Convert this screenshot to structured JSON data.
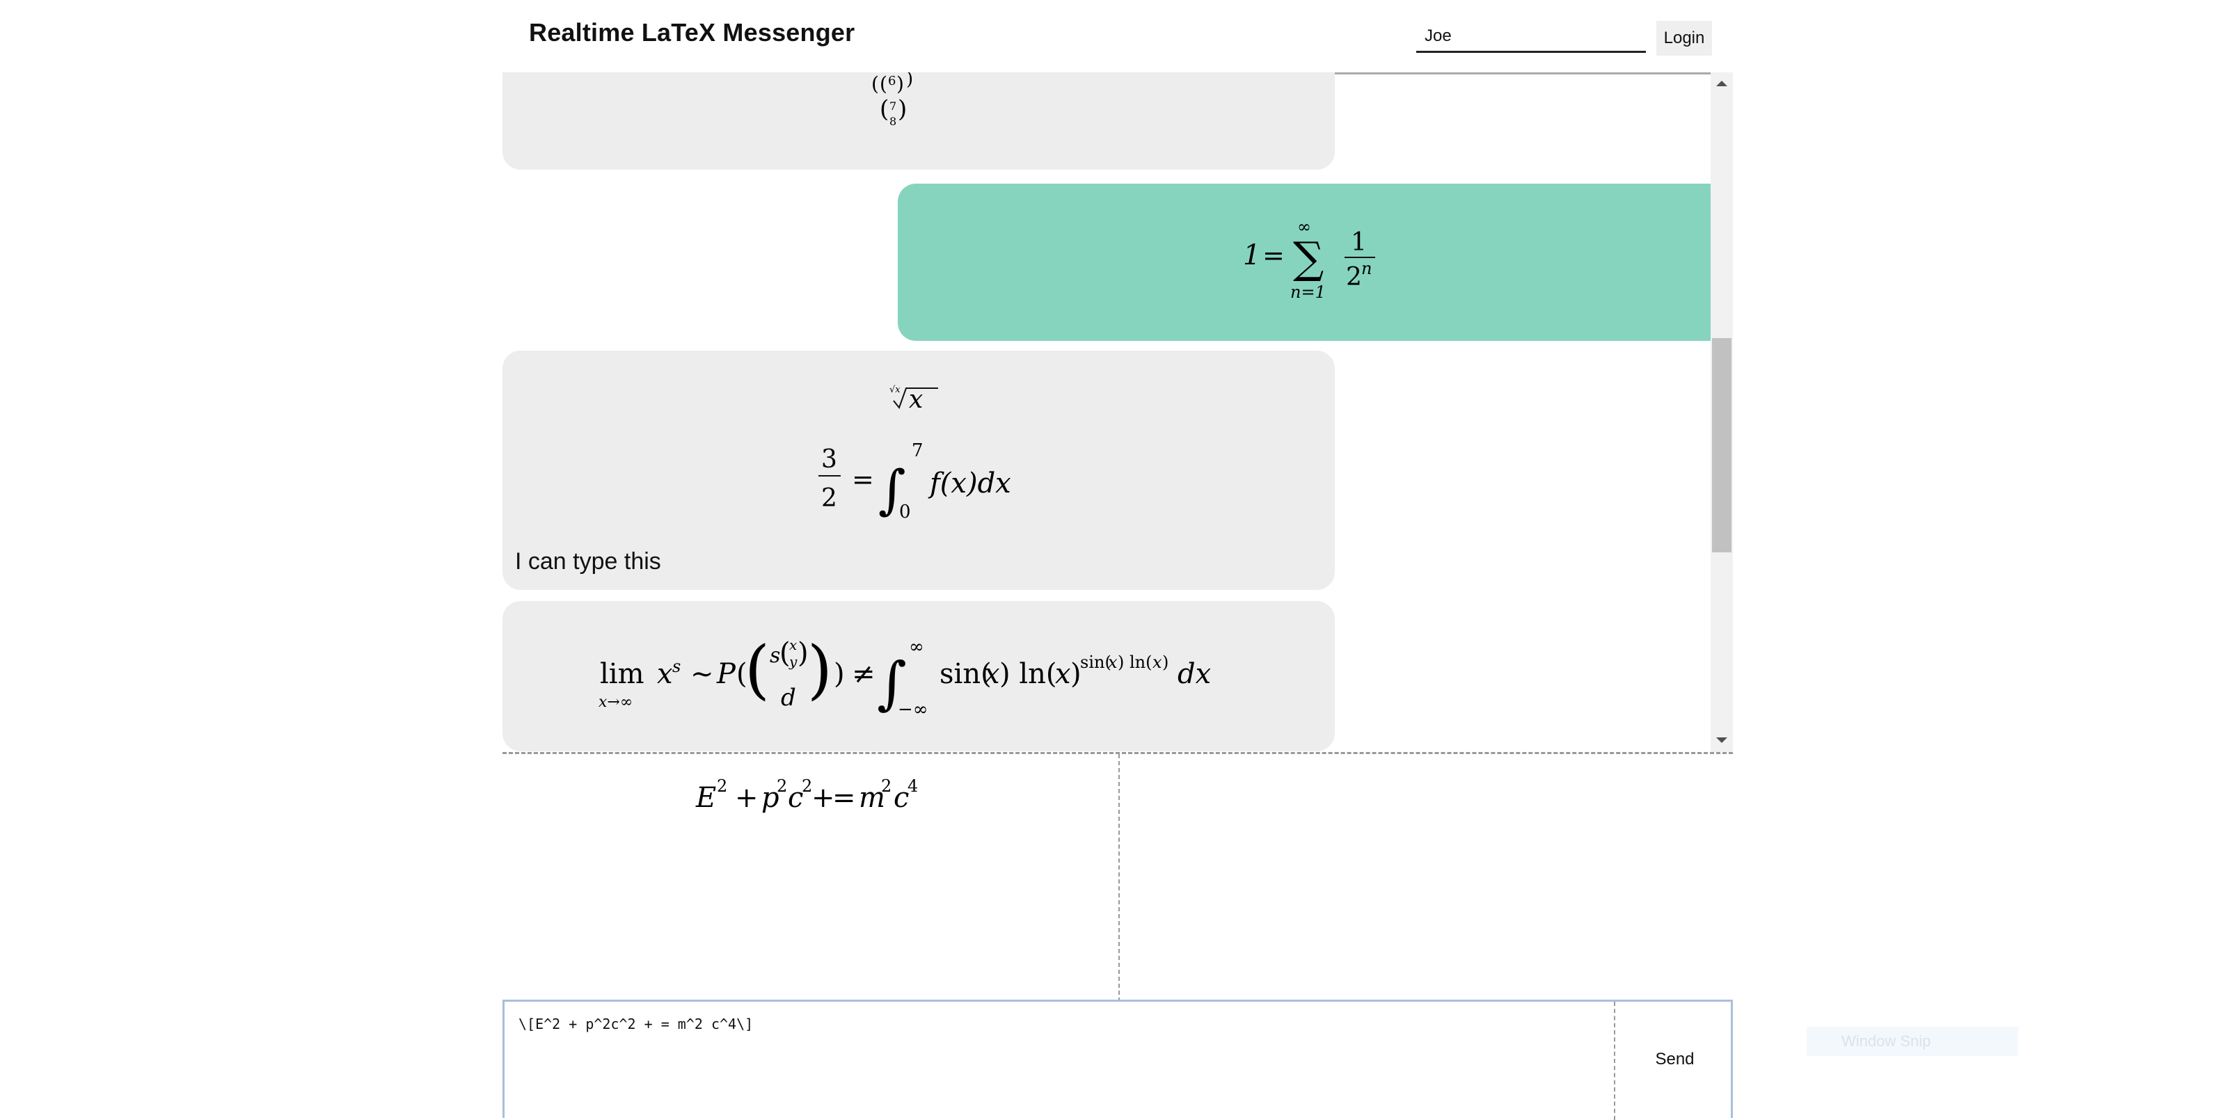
{
  "header": {
    "title": "Realtime LaTeX Messenger",
    "username": "Joe",
    "login_label": "Login"
  },
  "messages": [
    {
      "sender": "other",
      "source": "\\binom{6}{\\binom{7}{8}}"
    },
    {
      "sender": "self",
      "source": "1 = \\sum_{n=1}^{\\infty} \\frac{1}{2^n}"
    },
    {
      "sender": "other",
      "source": "\\sqrt[\\sqrt{x}]{x} \\quad \\frac{3}{2} = \\int_0^7 f(x)dx",
      "text": "I can type this"
    },
    {
      "sender": "other",
      "source": "\\lim_{x\\to\\infty} x^s \\sim P(\\binom{s\\binom{x}{y}}{d}) \\neq \\int_{-\\infty}^{\\infty} \\sin(x)\\ln(x)^{\\sin(x)\\ln(x)} dx"
    }
  ],
  "preview": {
    "source": "E^2 + p^2 c^2 + = m^2 c^4"
  },
  "composer": {
    "value": "\\[E^2 + p^2c^2 + = m^2 c^4\\]",
    "send_label": "Send"
  },
  "overlay": {
    "label": "Window Snip"
  },
  "colors": {
    "own_bubble": "#86d4bd",
    "other_bubble": "#ededed"
  }
}
